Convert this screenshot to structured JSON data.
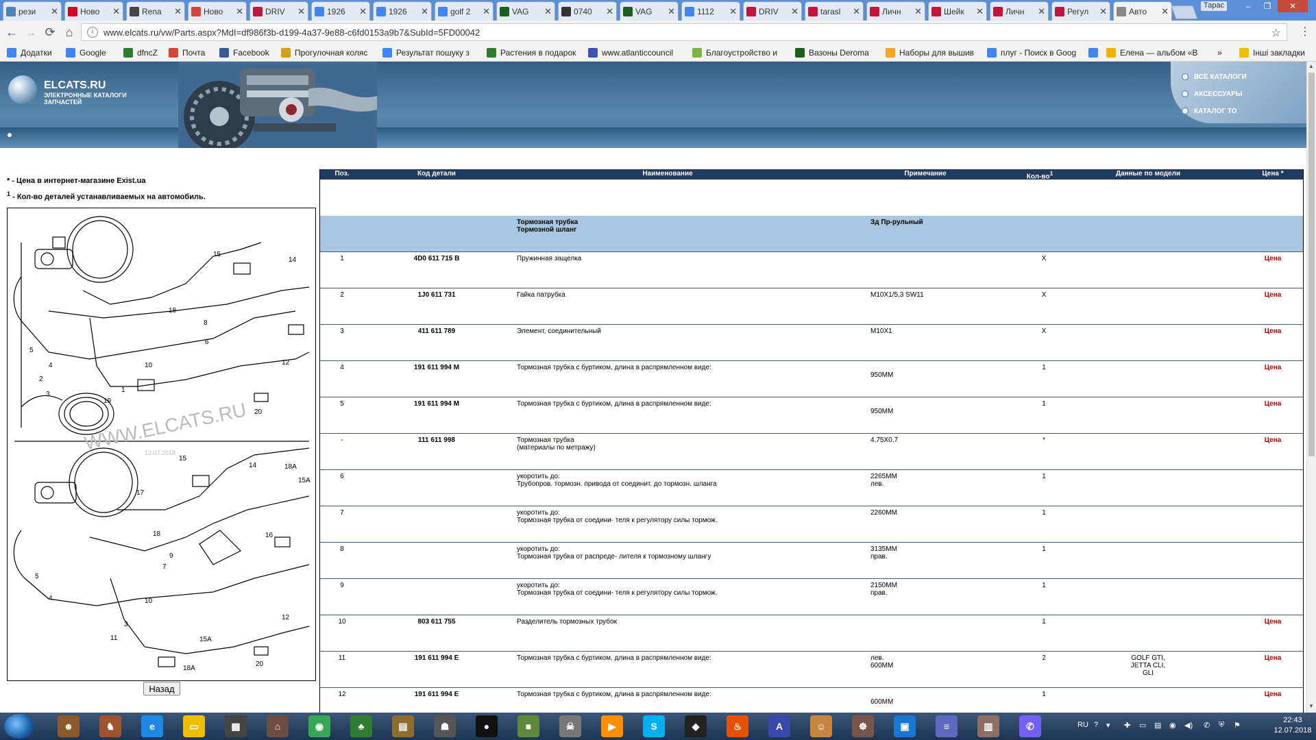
{
  "browser": {
    "tabs": [
      {
        "label": "рези",
        "icon": "vk-icon",
        "color": "#5181b8",
        "active": false
      },
      {
        "label": "Ново",
        "icon": "hh-icon",
        "color": "#d6001c",
        "active": false
      },
      {
        "label": "Rena",
        "icon": "renault-icon",
        "color": "#444444",
        "active": false
      },
      {
        "label": "Ново",
        "icon": "gmail-icon",
        "color": "#d44638",
        "active": false
      },
      {
        "label": "DRIV",
        "icon": "drive2-icon",
        "color": "#c4143c",
        "active": false
      },
      {
        "label": "1926",
        "icon": "google-icon",
        "color": "#4285f4",
        "active": false
      },
      {
        "label": "1926",
        "icon": "google-icon",
        "color": "#4285f4",
        "active": false
      },
      {
        "label": "golf 2",
        "icon": "google-icon",
        "color": "#4285f4",
        "active": false
      },
      {
        "label": "VAG",
        "icon": "vag-icon",
        "color": "#1b5e20",
        "active": false
      },
      {
        "label": "0740",
        "icon": "elcats-icon",
        "color": "#333333",
        "active": false
      },
      {
        "label": "VAG",
        "icon": "vag-icon",
        "color": "#1b5e20",
        "active": false
      },
      {
        "label": "1112",
        "icon": "google-icon",
        "color": "#4285f4",
        "active": false
      },
      {
        "label": "DRIV",
        "icon": "drive2-icon",
        "color": "#c4143c",
        "active": false
      },
      {
        "label": "tarasl",
        "icon": "drive2-icon",
        "color": "#c4143c",
        "active": false
      },
      {
        "label": "Личн",
        "icon": "drive2-icon",
        "color": "#c4143c",
        "active": false
      },
      {
        "label": "Шейк",
        "icon": "drive2-icon",
        "color": "#c4143c",
        "active": false
      },
      {
        "label": "Личн",
        "icon": "drive2-icon",
        "color": "#c4143c",
        "active": false
      },
      {
        "label": "Регул",
        "icon": "drive2-icon",
        "color": "#c4143c",
        "active": false
      },
      {
        "label": "Авто",
        "icon": "page-icon",
        "color": "#888888",
        "active": true
      }
    ],
    "user": "Тарас",
    "url": "www.elcats.ru/vw/Parts.aspx?MdI=df986f3b-d199-4a37-9e88-c6fd0153a9b7&SubId=5FD00042",
    "bookmarks": [
      {
        "label": "Додатки",
        "icon": "apps-icon",
        "color": "#4285f4"
      },
      {
        "label": "Google",
        "icon": "google-icon",
        "color": "#4285f4"
      },
      {
        "label": "dfncZ",
        "icon": "dfncz-icon",
        "color": "#2e7d32"
      },
      {
        "label": "Почта",
        "icon": "gmail-icon",
        "color": "#d44638"
      },
      {
        "label": "Facebook",
        "icon": "facebook-icon",
        "color": "#3b5998"
      },
      {
        "label": "Прогулочная коляс",
        "icon": "b-icon",
        "color": "#d4a017"
      },
      {
        "label": "Результат пошуку з",
        "icon": "google-icon",
        "color": "#4285f4"
      },
      {
        "label": "Растения в подарок",
        "icon": "plant-icon",
        "color": "#2e7d32"
      },
      {
        "label": "www.atlanticcouncil",
        "icon": "globe-icon",
        "color": "#3f51b5"
      },
      {
        "label": "Благоустройство и",
        "icon": "leaf-icon",
        "color": "#7cb342"
      },
      {
        "label": "Вазоны Deroma",
        "icon": "deroma-icon",
        "color": "#1b5e20"
      },
      {
        "label": "Наборы для вышив",
        "icon": "craft-icon",
        "color": "#f5a623"
      },
      {
        "label": "плуг - Поиск в Goog",
        "icon": "google-icon",
        "color": "#4285f4"
      },
      {
        "label": "",
        "icon": "google-icon",
        "color": "#4285f4"
      },
      {
        "label": "Елена — альбом «В",
        "icon": "album-icon",
        "color": "#f0b400"
      },
      {
        "label": "»",
        "icon": "",
        "color": ""
      },
      {
        "label": "Інші закладки",
        "icon": "folder-icon",
        "color": "#f0c000"
      }
    ]
  },
  "site": {
    "logo_title": "ELCATS.RU",
    "logo_subtitle": "ЭЛЕКТРОННЫЕ КАТАЛОГИ ЗАПЧАСТЕЙ",
    "menu": [
      "ВСЕ КАТАЛОГИ",
      "АКСЕССУАРЫ",
      "КАТАЛОГ ТО"
    ]
  },
  "notes": {
    "price_note_mark": "*",
    "price_note": " - Цена в интернет-магазине Exist.ua",
    "qty_note_mark": "1",
    "qty_note": " - Кол-во деталей устанавливаемых на автомобиль."
  },
  "diagram": {
    "watermark": "WWW.ELCATS.RU",
    "date_mark": "12.07.2018",
    "callouts_top": [
      "15",
      "14",
      "18",
      "8",
      "6",
      "5",
      "4",
      "10",
      "2",
      "3",
      "19",
      "1",
      "12",
      "20"
    ],
    "callouts_bottom": [
      "15",
      "14",
      "18A",
      "15A",
      "17",
      "16",
      "18",
      "9",
      "7",
      "5",
      "4",
      "10",
      "3",
      "11",
      "15A",
      "18A",
      "20",
      "12"
    ]
  },
  "back_button": "Назад",
  "table": {
    "headers": {
      "pos": "Поз.",
      "code": "Код детали",
      "name": "Наименование",
      "note": "Примечание",
      "qty": "Кол-во",
      "qty_sup": "1",
      "model": "Данные по модели",
      "price": "Цена *"
    },
    "group": {
      "name": "Тормозная трубка\nТормозной шланг",
      "note": "Зд Пр-рульный"
    },
    "rows": [
      {
        "pos": "1",
        "code": "4D0 611 715 B",
        "name": "Пружинная защелка",
        "note": "",
        "qty": "X",
        "model": "",
        "price": "Цена"
      },
      {
        "pos": "2",
        "code": "1J0 611 731",
        "name": "Гайка патрубка",
        "note": "M10X1/5,3 SW11",
        "qty": "X",
        "model": "",
        "price": "Цена"
      },
      {
        "pos": "3",
        "code": "411 611 789",
        "name": "Элемент, соединительный",
        "note": "M10X1",
        "qty": "X",
        "model": "",
        "price": "Цена"
      },
      {
        "pos": "4",
        "code": "191 611 994 M",
        "name": "Тормозная трубка с буртиком, длина в распрямленном виде:",
        "note": "\n950MM",
        "qty": "1",
        "model": "",
        "price": "Цена"
      },
      {
        "pos": "5",
        "code": "191 611 994 M",
        "name": "Тормозная трубка с буртиком, длина в распрямленном виде:",
        "note": "\n950MM",
        "qty": "1",
        "model": "",
        "price": "Цена"
      },
      {
        "pos": "-",
        "code": "111 611 998",
        "name": "Тормозная трубка\n(материалы по метражу)",
        "note": "4,75X0,7",
        "qty": "*",
        "model": "",
        "price": "Цена"
      },
      {
        "pos": "6",
        "code": "",
        "name": "укоротить до:\nТрубопров. тормозн. привода от соединит. до тормозн. шланга",
        "note": "2265MM\nлев.",
        "qty": "1",
        "model": "",
        "price": ""
      },
      {
        "pos": "7",
        "code": "",
        "name": "укоротить до:\nТормозная трубка от соедини- теля к регулятору силы тормож.",
        "note": "2260MM",
        "qty": "1",
        "model": "",
        "price": ""
      },
      {
        "pos": "8",
        "code": "",
        "name": "укоротить до:\nТормозная трубка от распреде- лителя к тормозному шлангу",
        "note": "3135MM\nправ.",
        "qty": "1",
        "model": "",
        "price": ""
      },
      {
        "pos": "9",
        "code": "",
        "name": "укоротить до:\nТормозная трубка от соедини- теля к регулятору силы тормож.",
        "note": "2150MM\nправ.",
        "qty": "1",
        "model": "",
        "price": ""
      },
      {
        "pos": "10",
        "code": "803 611 755",
        "name": "Разделитель тормозных трубок",
        "note": "",
        "qty": "1",
        "model": "",
        "price": "Цена"
      },
      {
        "pos": "11",
        "code": "191 611 994 E",
        "name": "Тормозная трубка с буртиком, длина в распрямленном виде:",
        "note": "лев.\n600MM",
        "qty": "2",
        "model": "GOLF GTI,\nJETTA CLI,\nGLI",
        "price": "Цена"
      },
      {
        "pos": "12",
        "code": "191 611 994 E",
        "name": "Тормозная трубка с буртиком, длина в распрямленном виде:",
        "note": "\n600MM",
        "qty": "1",
        "model": "",
        "price": "Цена"
      }
    ]
  },
  "taskbar": {
    "apps": [
      {
        "name": "explorer-user-icon",
        "color": "#8b5a2b",
        "glyph": "☻"
      },
      {
        "name": "game-icon",
        "color": "#a0522d",
        "glyph": "♞"
      },
      {
        "name": "ie-icon",
        "color": "#1e88e5",
        "glyph": "e"
      },
      {
        "name": "folder-icon",
        "color": "#f0c000",
        "glyph": "▭"
      },
      {
        "name": "film-icon",
        "color": "#444444",
        "glyph": "▦"
      },
      {
        "name": "monument-icon",
        "color": "#6d4c41",
        "glyph": "⌂"
      },
      {
        "name": "chrome-icon",
        "color": "#34a853",
        "glyph": "◉"
      },
      {
        "name": "palm-icon",
        "color": "#2e7d32",
        "glyph": "♣"
      },
      {
        "name": "book-icon",
        "color": "#8d6e2f",
        "glyph": "▤"
      },
      {
        "name": "cs-icon",
        "color": "#555555",
        "glyph": "☗"
      },
      {
        "name": "record-icon",
        "color": "#111111",
        "glyph": "●"
      },
      {
        "name": "minecraft-icon",
        "color": "#5d8a3a",
        "glyph": "■"
      },
      {
        "name": "skull-icon",
        "color": "#777777",
        "glyph": "☠"
      },
      {
        "name": "media-icon",
        "color": "#ff8f00",
        "glyph": "▶"
      },
      {
        "name": "skype-icon",
        "color": "#00aff0",
        "glyph": "S"
      },
      {
        "name": "diamond-icon",
        "color": "#222222",
        "glyph": "◆"
      },
      {
        "name": "chicken-icon",
        "color": "#e65100",
        "glyph": "♨"
      },
      {
        "name": "avast-icon",
        "color": "#3949ab",
        "glyph": "A"
      },
      {
        "name": "avatar-icon",
        "color": "#c68642",
        "glyph": "☺"
      },
      {
        "name": "pirate-icon",
        "color": "#795548",
        "glyph": "☸"
      },
      {
        "name": "photo-icon",
        "color": "#1976d2",
        "glyph": "▣"
      },
      {
        "name": "stack-icon",
        "color": "#5c6bc0",
        "glyph": "≡"
      },
      {
        "name": "chest-icon",
        "color": "#8d6e63",
        "glyph": "▥"
      },
      {
        "name": "viber-icon",
        "color": "#7360f2",
        "glyph": "✆"
      }
    ],
    "lang": "RU",
    "time": "22:43",
    "date": "12.07.2018"
  }
}
